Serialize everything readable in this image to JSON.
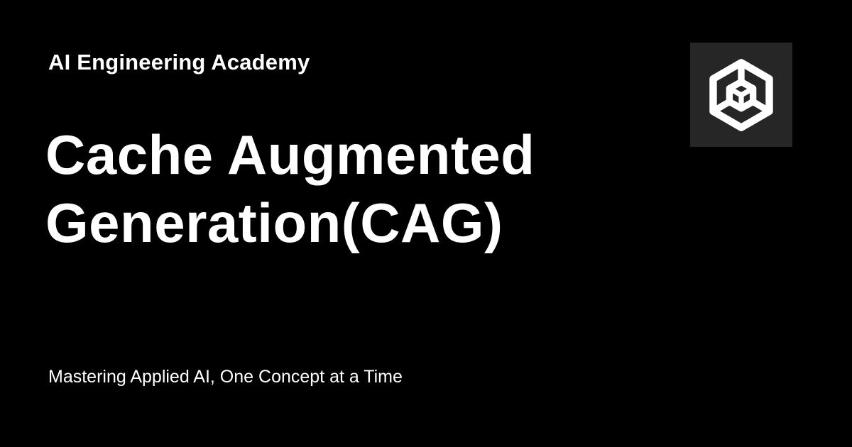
{
  "header": {
    "site_name": "AI Engineering Academy"
  },
  "main": {
    "title_lines": [
      "Cache Augmented",
      "Generation(CAG)"
    ]
  },
  "footer": {
    "tagline": "Mastering Applied AI, One Concept at a Time"
  },
  "logo": {
    "icon": "hexagon-cube-icon",
    "background_color": "#262626",
    "foreground_color": "#ffffff"
  },
  "colors": {
    "background": "#000000",
    "text": "#ffffff"
  }
}
